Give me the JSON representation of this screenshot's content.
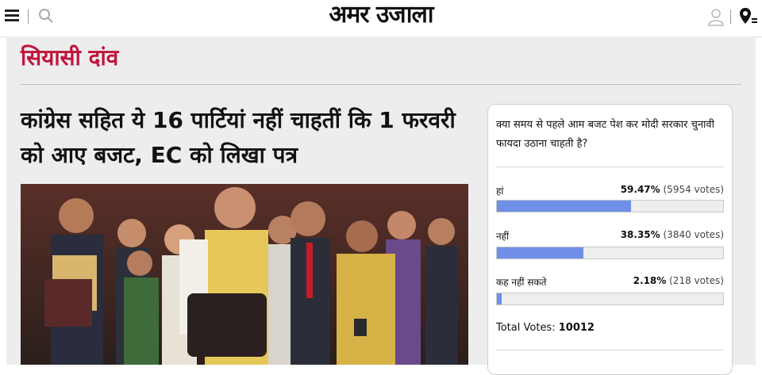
{
  "header": {
    "logo_text": "अमर उजाला",
    "icons": [
      "menu-icon",
      "search-icon",
      "user-icon",
      "location-icon"
    ]
  },
  "section": {
    "title": "सियासी दांव"
  },
  "article": {
    "headline": "कांग्रेस सहित ये 16 पार्टियां नहीं चाहतीं कि 1 फरवरी को आए बजट, EC को लिखा पत्र"
  },
  "poll": {
    "question": "क्या समय से पहले आम बजट पेश कर मोदी सरकार चुनावी फायदा उठाना चाहती है?",
    "options": [
      {
        "label": "हां",
        "percent": "59.47%",
        "votes": "(5954 votes)",
        "fraction": 0.5947
      },
      {
        "label": "नहीं",
        "percent": "38.35%",
        "votes": "(3840 votes)",
        "fraction": 0.3835
      },
      {
        "label": "कह नहीं सकते",
        "percent": "2.18%",
        "votes": "(218 votes)",
        "fraction": 0.0218
      }
    ],
    "total_label": "Total Votes:",
    "total_value": "10012",
    "bar_color": "#6f8fe8"
  },
  "colors": {
    "section_title": "#c0143c",
    "panel_bg": "#ededed"
  }
}
